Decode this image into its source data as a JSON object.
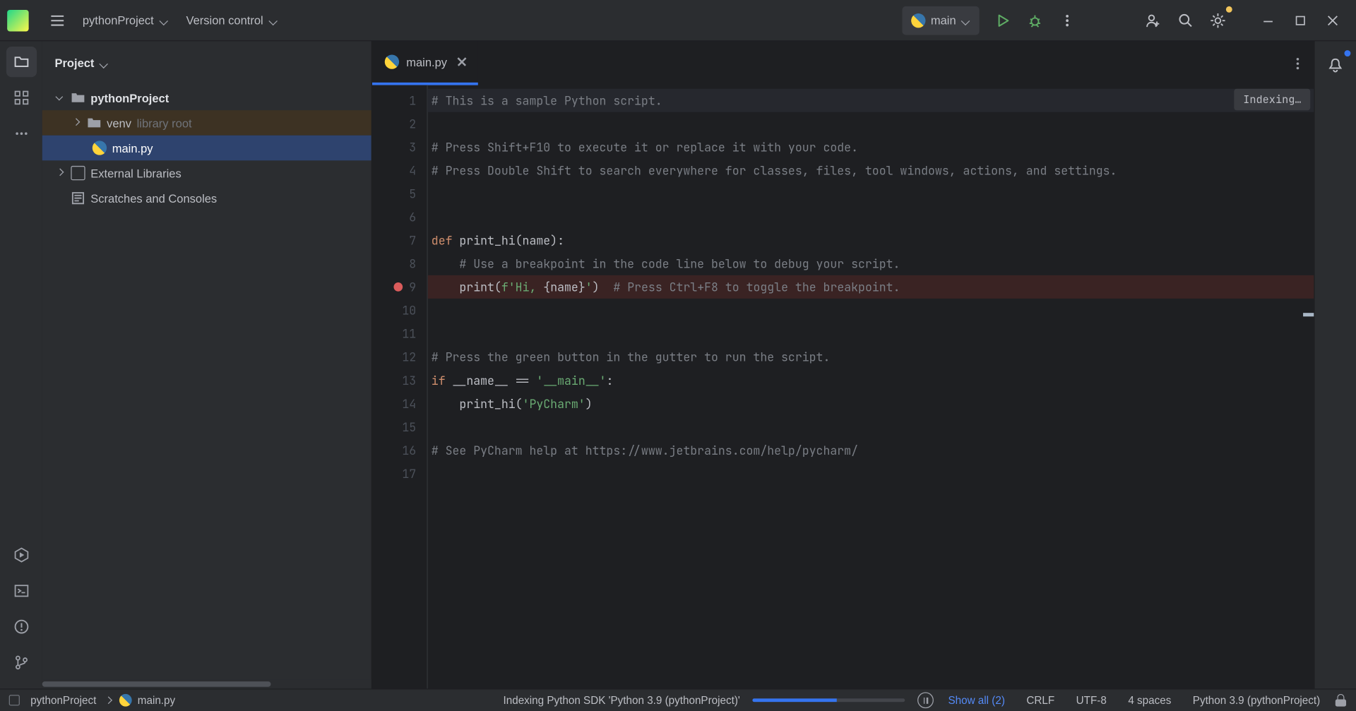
{
  "titlebar": {
    "project": "pythonProject",
    "vcs": "Version control",
    "run_config": "main"
  },
  "panel": {
    "title": "Project",
    "nodes": {
      "root": "pythonProject",
      "venv": "venv",
      "venv_hint": "library root",
      "main": "main.py",
      "external": "External Libraries",
      "scratches": "Scratches and Consoles"
    }
  },
  "tab": {
    "file": "main.py"
  },
  "indexing_badge": "Indexing…",
  "code": {
    "l1": "# This is a sample Python script.",
    "l3": "# Press Shift+F10 to execute it or replace it with your code.",
    "l4": "# Press Double Shift to search everywhere for classes, files, tool windows, actions, and settings.",
    "l7_def": "def ",
    "l7_name": "print_hi(name):",
    "l8": "    # Use a breakpoint in the code line below to debug your script.",
    "l9a": "    print(",
    "l9b": "f'Hi, ",
    "l9c": "{name}",
    "l9d": "'",
    "l9e": ")  ",
    "l9f": "# Press Ctrl+F8 to toggle the breakpoint.",
    "l12": "# Press the green button in the gutter to run the script.",
    "l13_if": "if ",
    "l13_name": "__name__ == ",
    "l13_str": "'__main__'",
    "l13_colon": ":",
    "l14a": "    print_hi(",
    "l14b": "'PyCharm'",
    "l14c": ")",
    "l16": "# See PyCharm help at https://www.jetbrains.com/help/pycharm/"
  },
  "lines": [
    "1",
    "2",
    "3",
    "4",
    "5",
    "6",
    "7",
    "8",
    "9",
    "10",
    "11",
    "12",
    "13",
    "14",
    "15",
    "16",
    "17"
  ],
  "status": {
    "crumb_project": "pythonProject",
    "crumb_file": "main.py",
    "indexing": "Indexing Python SDK 'Python 3.9 (pythonProject)'",
    "show_all": "Show all (2)",
    "crlf": "CRLF",
    "enc": "UTF-8",
    "indent": "4 spaces",
    "interp": "Python 3.9 (pythonProject)"
  }
}
